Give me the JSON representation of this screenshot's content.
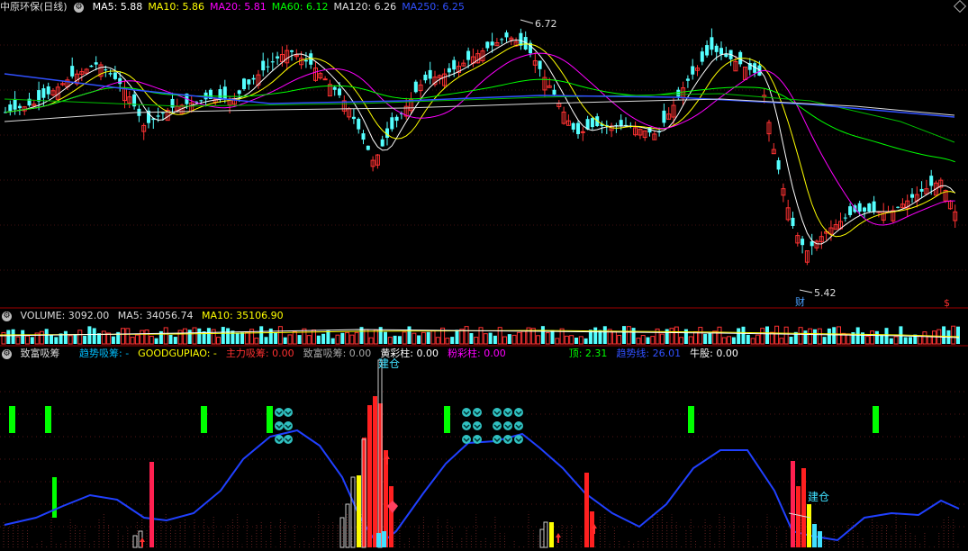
{
  "main": {
    "title": "中原环保(日线)",
    "ma": [
      {
        "label": "MA5: 5.88",
        "color": "#ffffff"
      },
      {
        "label": "MA10: 5.86",
        "color": "#ffff00"
      },
      {
        "label": "MA20: 5.81",
        "color": "#ff00ff"
      },
      {
        "label": "MA60: 6.12",
        "color": "#00ff00"
      },
      {
        "label": "MA120: 6.26",
        "color": "#dddddd"
      },
      {
        "label": "MA250: 6.25",
        "color": "#3050ff"
      }
    ],
    "high_label": "6.72",
    "low_label": "5.42",
    "cai_label": "财",
    "s_label": "$"
  },
  "volume": {
    "label": "VOLUME: 3092.00",
    "ma5": "MA5: 34056.74",
    "ma10": "MA10: 35106.90"
  },
  "indicator": {
    "name": "致富吸筹",
    "items": [
      {
        "label": "趋势吸筹: -",
        "color": "#00bfff"
      },
      {
        "label": "GOODGUPIAO: -",
        "color": "#ffff00"
      },
      {
        "label": "主力吸筹: 0.00",
        "color": "#ff3030"
      },
      {
        "label": "致富吸筹: 0.00",
        "color": "#aaaaaa"
      },
      {
        "label": "黄彩柱: 0.00",
        "color": "#ffffff"
      },
      {
        "label": "粉彩柱: 0.00",
        "color": "#ff00ff"
      },
      {
        "label": "顶: 2.31",
        "color": "#00ff00"
      },
      {
        "label": "趋势线: 26.01",
        "color": "#3050ff"
      },
      {
        "label": "牛股: 0.00",
        "color": "#ffffff"
      }
    ],
    "jiancang_label": "建仓",
    "jiancang_top": "建仓"
  },
  "chart_data": {
    "type": "candlestick",
    "candle_count": 200,
    "price_range": [
      5.35,
      6.8
    ],
    "high": 6.72,
    "low": 5.42,
    "ma_last": {
      "MA5": 5.88,
      "MA10": 5.86,
      "MA20": 5.81,
      "MA60": 6.12,
      "MA120": 6.26,
      "MA250": 6.25
    },
    "volume_last": 3092.0,
    "volume_ma5": 34056.74,
    "volume_ma10": 35106.9
  }
}
